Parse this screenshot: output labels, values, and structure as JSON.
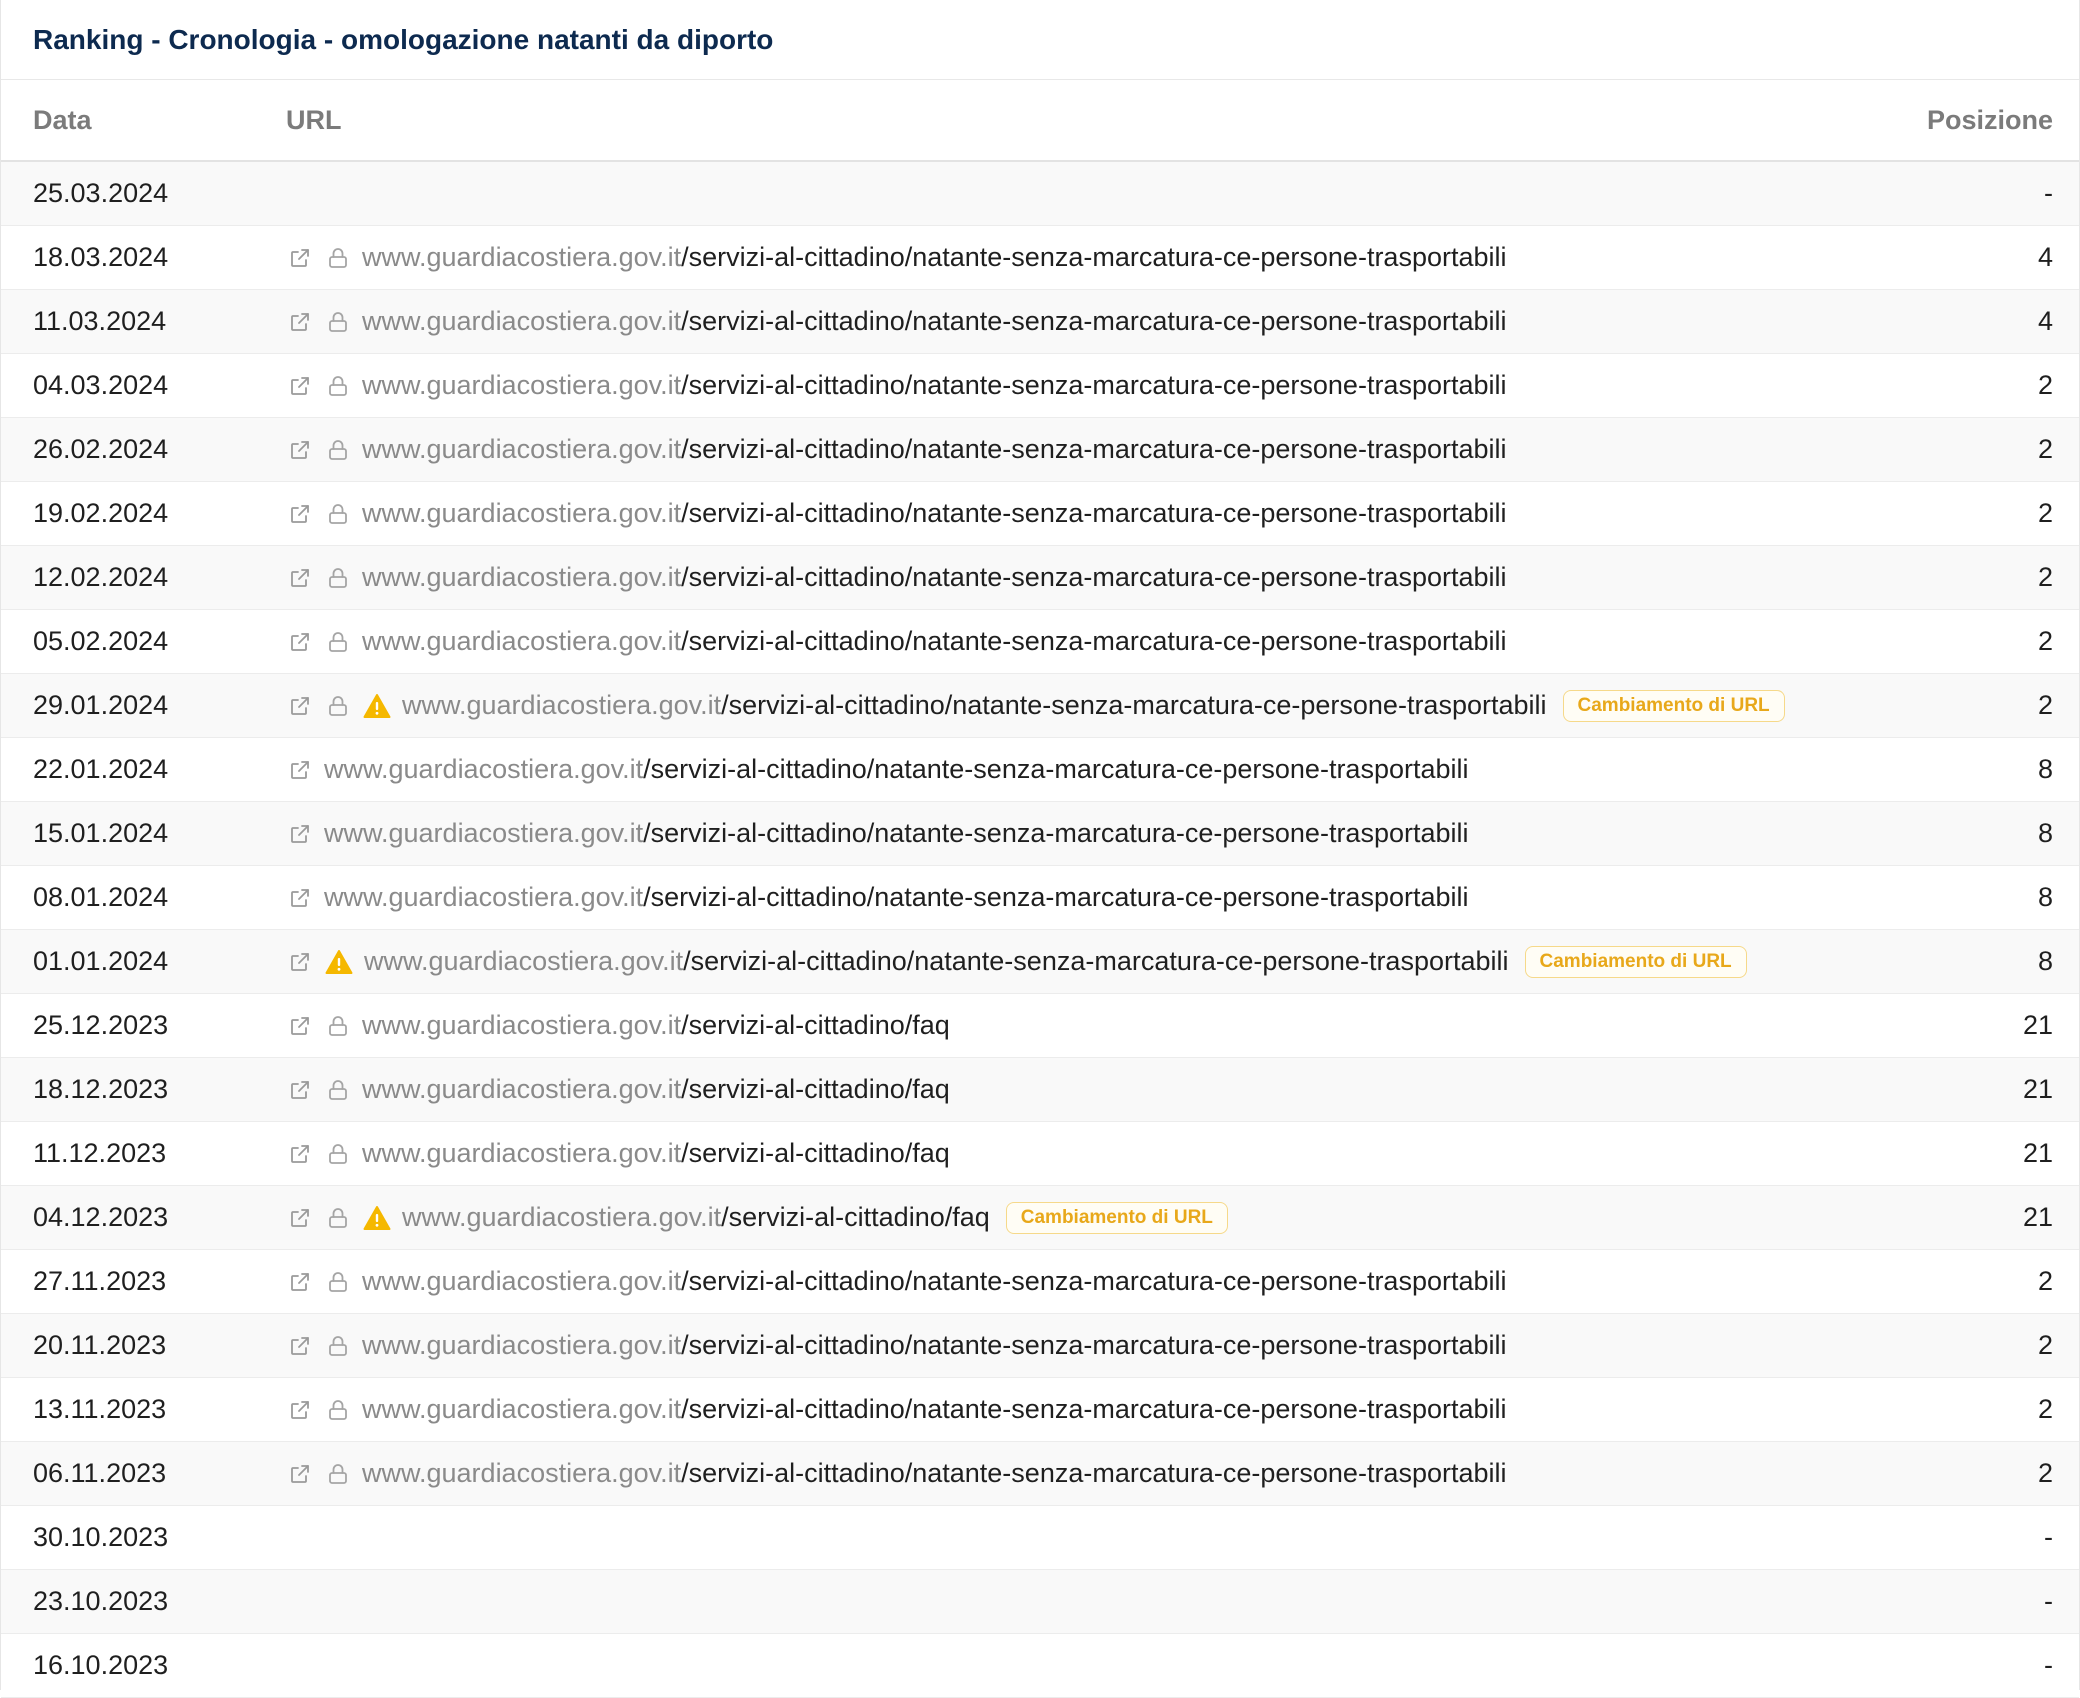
{
  "panel": {
    "title": "Ranking - Cronologia - omologazione natanti da diporto"
  },
  "table": {
    "headers": {
      "date": "Data",
      "url": "URL",
      "position": "Posizione"
    },
    "rows": [
      {
        "date": "25.03.2024",
        "domain": "",
        "path": "",
        "external": false,
        "lock": false,
        "warning": false,
        "badge": "",
        "position": "-"
      },
      {
        "date": "18.03.2024",
        "domain": "www.guardiacostiera.gov.it",
        "path": "/servizi-al-cittadino/natante-senza-marcatura-ce-persone-trasportabili",
        "external": true,
        "lock": true,
        "warning": false,
        "badge": "",
        "position": "4"
      },
      {
        "date": "11.03.2024",
        "domain": "www.guardiacostiera.gov.it",
        "path": "/servizi-al-cittadino/natante-senza-marcatura-ce-persone-trasportabili",
        "external": true,
        "lock": true,
        "warning": false,
        "badge": "",
        "position": "4"
      },
      {
        "date": "04.03.2024",
        "domain": "www.guardiacostiera.gov.it",
        "path": "/servizi-al-cittadino/natante-senza-marcatura-ce-persone-trasportabili",
        "external": true,
        "lock": true,
        "warning": false,
        "badge": "",
        "position": "2"
      },
      {
        "date": "26.02.2024",
        "domain": "www.guardiacostiera.gov.it",
        "path": "/servizi-al-cittadino/natante-senza-marcatura-ce-persone-trasportabili",
        "external": true,
        "lock": true,
        "warning": false,
        "badge": "",
        "position": "2"
      },
      {
        "date": "19.02.2024",
        "domain": "www.guardiacostiera.gov.it",
        "path": "/servizi-al-cittadino/natante-senza-marcatura-ce-persone-trasportabili",
        "external": true,
        "lock": true,
        "warning": false,
        "badge": "",
        "position": "2"
      },
      {
        "date": "12.02.2024",
        "domain": "www.guardiacostiera.gov.it",
        "path": "/servizi-al-cittadino/natante-senza-marcatura-ce-persone-trasportabili",
        "external": true,
        "lock": true,
        "warning": false,
        "badge": "",
        "position": "2"
      },
      {
        "date": "05.02.2024",
        "domain": "www.guardiacostiera.gov.it",
        "path": "/servizi-al-cittadino/natante-senza-marcatura-ce-persone-trasportabili",
        "external": true,
        "lock": true,
        "warning": false,
        "badge": "",
        "position": "2"
      },
      {
        "date": "29.01.2024",
        "domain": "www.guardiacostiera.gov.it",
        "path": "/servizi-al-cittadino/natante-senza-marcatura-ce-persone-trasportabili",
        "external": true,
        "lock": true,
        "warning": true,
        "badge": "Cambiamento di URL",
        "position": "2"
      },
      {
        "date": "22.01.2024",
        "domain": "www.guardiacostiera.gov.it",
        "path": "/servizi-al-cittadino/natante-senza-marcatura-ce-persone-trasportabili",
        "external": true,
        "lock": false,
        "warning": false,
        "badge": "",
        "position": "8"
      },
      {
        "date": "15.01.2024",
        "domain": "www.guardiacostiera.gov.it",
        "path": "/servizi-al-cittadino/natante-senza-marcatura-ce-persone-trasportabili",
        "external": true,
        "lock": false,
        "warning": false,
        "badge": "",
        "position": "8"
      },
      {
        "date": "08.01.2024",
        "domain": "www.guardiacostiera.gov.it",
        "path": "/servizi-al-cittadino/natante-senza-marcatura-ce-persone-trasportabili",
        "external": true,
        "lock": false,
        "warning": false,
        "badge": "",
        "position": "8"
      },
      {
        "date": "01.01.2024",
        "domain": "www.guardiacostiera.gov.it",
        "path": "/servizi-al-cittadino/natante-senza-marcatura-ce-persone-trasportabili",
        "external": true,
        "lock": false,
        "warning": true,
        "badge": "Cambiamento di URL",
        "position": "8"
      },
      {
        "date": "25.12.2023",
        "domain": "www.guardiacostiera.gov.it",
        "path": "/servizi-al-cittadino/faq",
        "external": true,
        "lock": true,
        "warning": false,
        "badge": "",
        "position": "21"
      },
      {
        "date": "18.12.2023",
        "domain": "www.guardiacostiera.gov.it",
        "path": "/servizi-al-cittadino/faq",
        "external": true,
        "lock": true,
        "warning": false,
        "badge": "",
        "position": "21"
      },
      {
        "date": "11.12.2023",
        "domain": "www.guardiacostiera.gov.it",
        "path": "/servizi-al-cittadino/faq",
        "external": true,
        "lock": true,
        "warning": false,
        "badge": "",
        "position": "21"
      },
      {
        "date": "04.12.2023",
        "domain": "www.guardiacostiera.gov.it",
        "path": "/servizi-al-cittadino/faq",
        "external": true,
        "lock": true,
        "warning": true,
        "badge": "Cambiamento di URL",
        "position": "21"
      },
      {
        "date": "27.11.2023",
        "domain": "www.guardiacostiera.gov.it",
        "path": "/servizi-al-cittadino/natante-senza-marcatura-ce-persone-trasportabili",
        "external": true,
        "lock": true,
        "warning": false,
        "badge": "",
        "position": "2"
      },
      {
        "date": "20.11.2023",
        "domain": "www.guardiacostiera.gov.it",
        "path": "/servizi-al-cittadino/natante-senza-marcatura-ce-persone-trasportabili",
        "external": true,
        "lock": true,
        "warning": false,
        "badge": "",
        "position": "2"
      },
      {
        "date": "13.11.2023",
        "domain": "www.guardiacostiera.gov.it",
        "path": "/servizi-al-cittadino/natante-senza-marcatura-ce-persone-trasportabili",
        "external": true,
        "lock": true,
        "warning": false,
        "badge": "",
        "position": "2"
      },
      {
        "date": "06.11.2023",
        "domain": "www.guardiacostiera.gov.it",
        "path": "/servizi-al-cittadino/natante-senza-marcatura-ce-persone-trasportabili",
        "external": true,
        "lock": true,
        "warning": false,
        "badge": "",
        "position": "2"
      },
      {
        "date": "30.10.2023",
        "domain": "",
        "path": "",
        "external": false,
        "lock": false,
        "warning": false,
        "badge": "",
        "position": "-"
      },
      {
        "date": "23.10.2023",
        "domain": "",
        "path": "",
        "external": false,
        "lock": false,
        "warning": false,
        "badge": "",
        "position": "-"
      },
      {
        "date": "16.10.2023",
        "domain": "",
        "path": "",
        "external": false,
        "lock": false,
        "warning": false,
        "badge": "",
        "position": "-"
      }
    ]
  },
  "colors": {
    "title": "#0d2a4f",
    "domain": "#8a8a8a",
    "warning": "#f5b800",
    "badge_text": "#e8a81a",
    "badge_border": "#f6d98a"
  },
  "icons": {
    "external": "external-link-icon",
    "lock": "lock-icon",
    "warning": "warning-icon"
  }
}
